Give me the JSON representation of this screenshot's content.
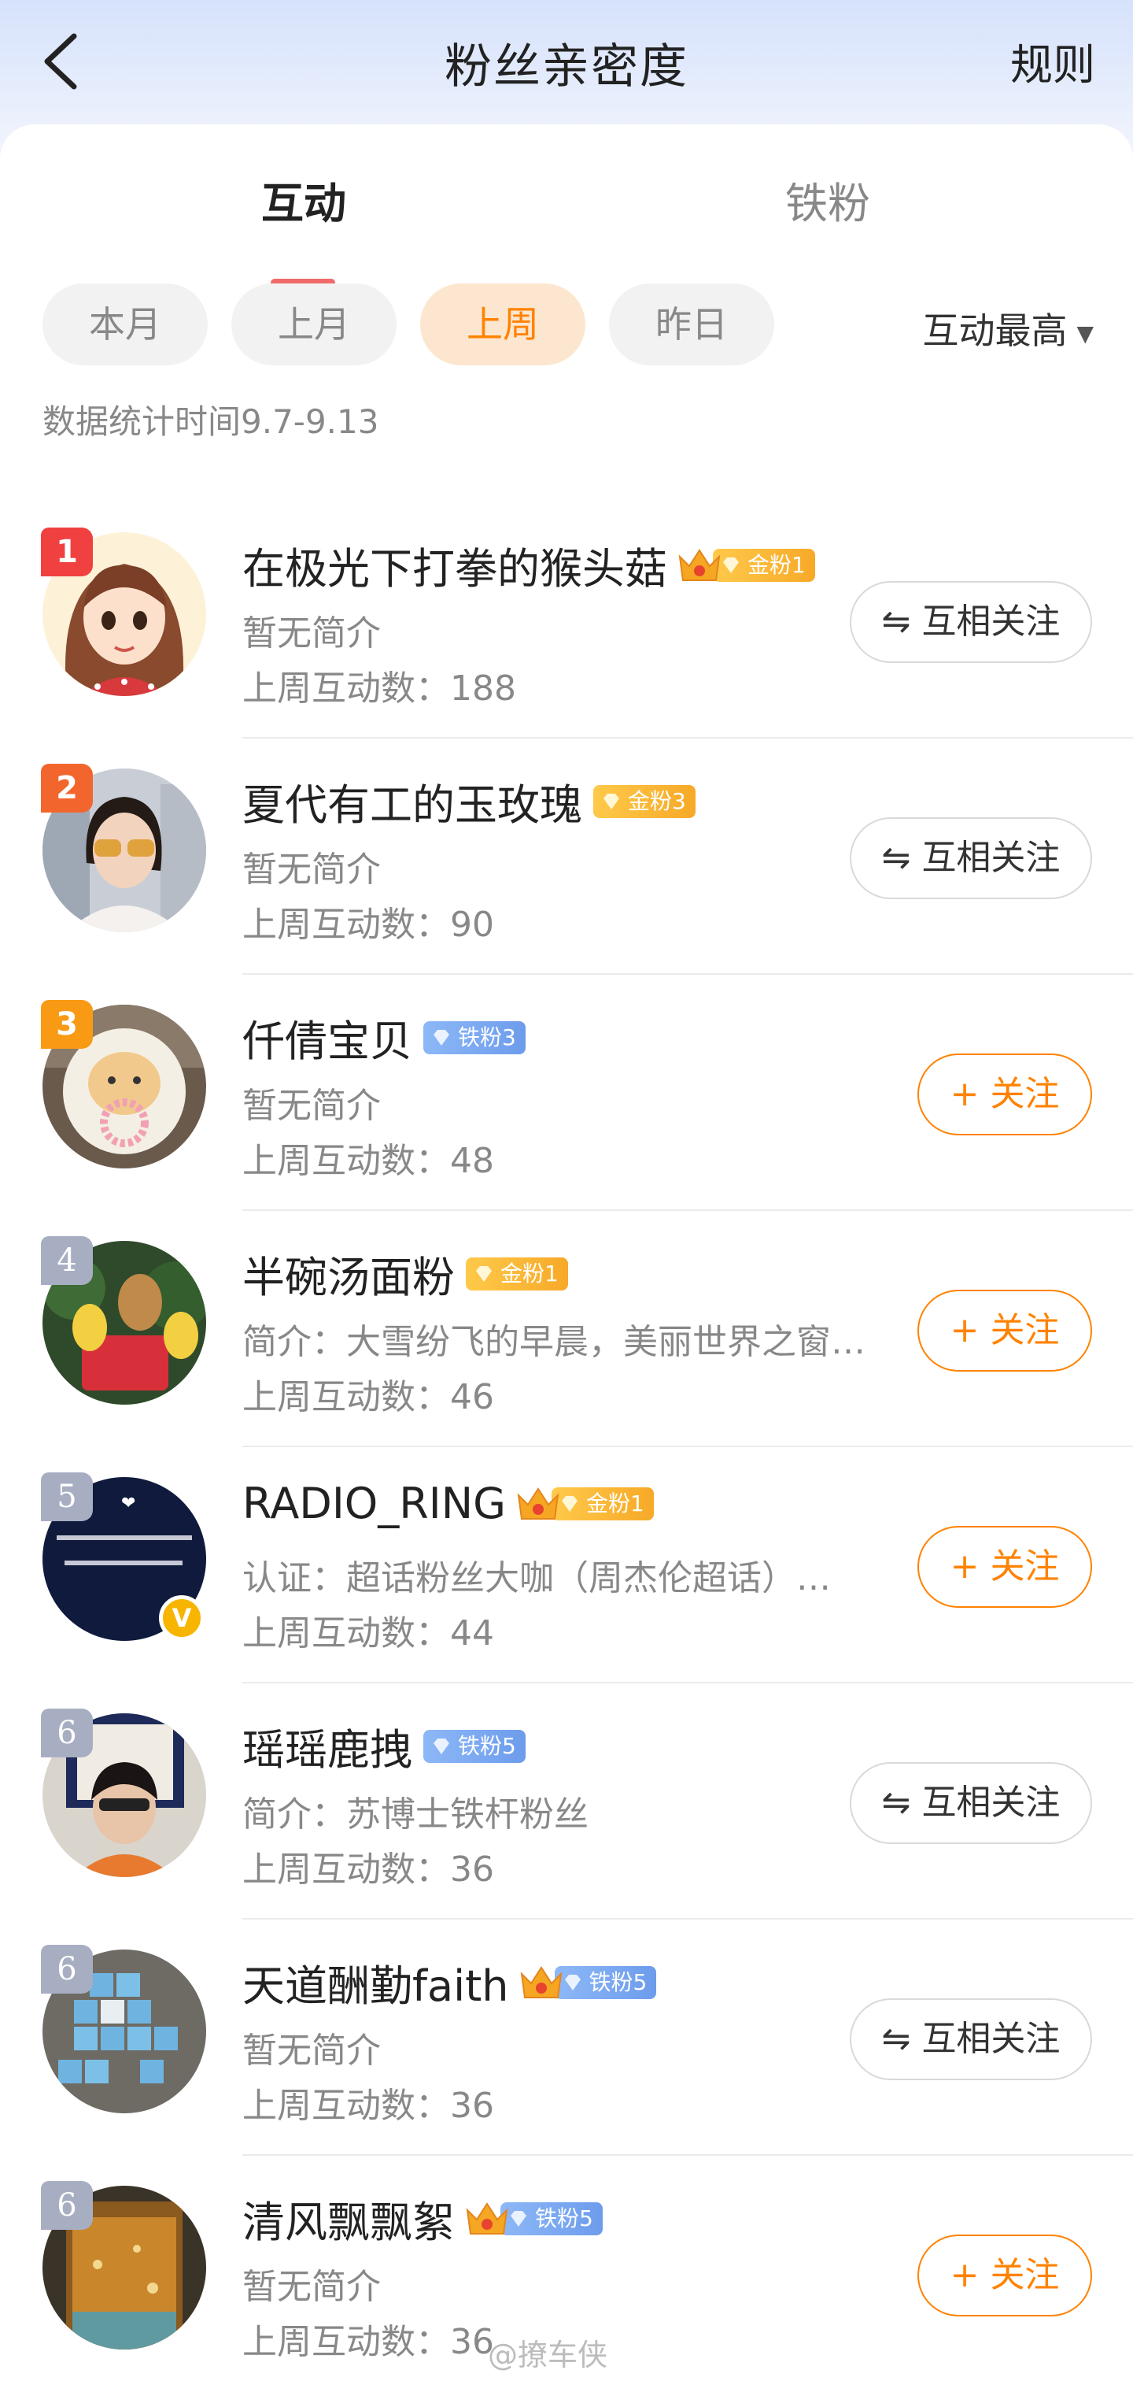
{
  "header": {
    "title": "粉丝亲密度",
    "rule_label": "规则"
  },
  "tabs": [
    {
      "label": "互动"
    },
    {
      "label": "铁粉"
    }
  ],
  "filters": [
    {
      "label": "本月"
    },
    {
      "label": "上月"
    },
    {
      "label": "上周",
      "selected": true
    },
    {
      "label": "昨日"
    }
  ],
  "sort": {
    "label": "互动最高"
  },
  "stat_time": "数据统计时间9.7-9.13",
  "fans": [
    {
      "rank": "1",
      "name": "在极光下打拳的猴头菇",
      "badge": "金粉1",
      "badge_type": "gold",
      "crown": true,
      "bio": "暂无简介",
      "count": "上周互动数：188",
      "action": "互相关注"
    },
    {
      "rank": "2",
      "name": "夏代有工的玉玫瑰",
      "badge": "金粉3",
      "badge_type": "gold",
      "crown": false,
      "bio": "暂无简介",
      "count": "上周互动数：90",
      "action": "互相关注"
    },
    {
      "rank": "3",
      "name": "仟倩宝贝",
      "badge": "铁粉3",
      "badge_type": "iron",
      "crown": false,
      "bio": "暂无简介",
      "count": "上周互动数：48",
      "action": "关注"
    },
    {
      "rank": "4",
      "name": "半碗汤面粉",
      "badge": "金粉1",
      "badge_type": "gold",
      "crown": false,
      "bio": "简介：大雪纷飞的早晨，美丽世界之窗…",
      "count": "上周互动数：46",
      "action": "关注"
    },
    {
      "rank": "5",
      "name": "RADIO_RING",
      "badge": "金粉1",
      "badge_type": "gold",
      "crown": true,
      "bio": "认证：超话粉丝大咖（周杰伦超话）…",
      "count": "上周互动数：44",
      "action": "关注",
      "verified": "V"
    },
    {
      "rank": "6",
      "name": "瑶瑶鹿拽",
      "badge": "铁粉5",
      "badge_type": "iron",
      "crown": false,
      "bio": "简介：苏博士铁杆粉丝",
      "count": "上周互动数：36",
      "action": "互相关注"
    },
    {
      "rank": "6",
      "name": "天道酬勤faith",
      "badge": "铁粉5",
      "badge_type": "iron",
      "crown": true,
      "bio": "暂无简介",
      "count": "上周互动数：36",
      "action": "互相关注"
    },
    {
      "rank": "6",
      "name": "清风飘飘絮",
      "badge": "铁粉5",
      "badge_type": "iron",
      "crown": true,
      "bio": "暂无简介",
      "count": "上周互动数：36",
      "action": "关注"
    }
  ],
  "watermark": "@撩车侠",
  "colors": {
    "accent": "#ff8200",
    "tab_underline": "#f06a6a",
    "selected_chip_bg": "#fde6cf"
  },
  "icons": {
    "back": "chevron-left-icon",
    "sort": "triangle-down-icon",
    "mutual": "swap-arrows-icon",
    "follow": "plus-icon"
  }
}
